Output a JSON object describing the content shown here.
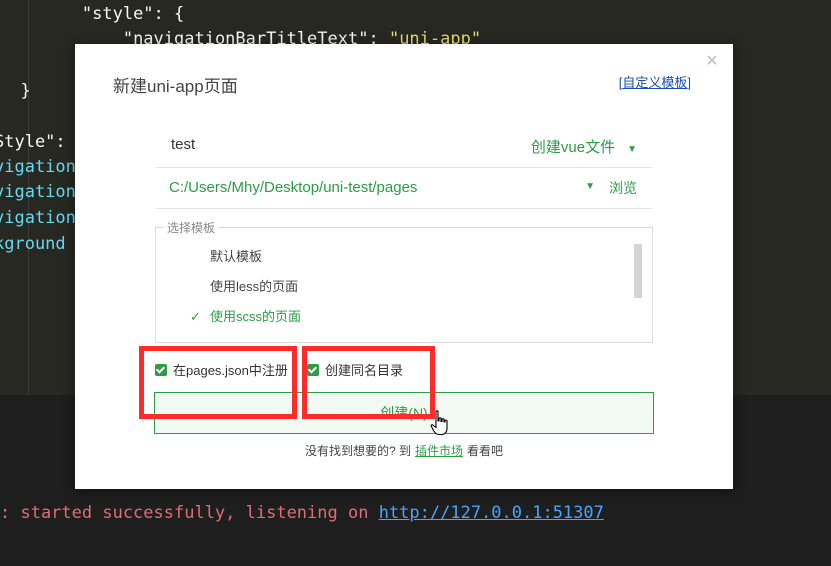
{
  "editor": {
    "lines": [
      {
        "indent": "        ",
        "key": "\"style\"",
        "rest": ": {"
      },
      {
        "indent": "            ",
        "key": "\"navigationBarTitleText\"",
        "rest": ": ",
        "value": "\"uni-app\""
      },
      {
        "indent": "        ",
        "key": "",
        "rest": "}"
      },
      {
        "indent": "  ",
        "key": "",
        "rest": "}"
      }
    ],
    "side_lines": [
      "Style\":",
      "vigation",
      "vigation",
      "vigation",
      "kground"
    ]
  },
  "terminal": {
    "prefix": ": started successfully, listening on ",
    "url": "http://127.0.0.1:51307"
  },
  "dialog": {
    "title": "新建uni-app页面",
    "close_glyph": "×",
    "custom_template": {
      "open": "[",
      "label": "自定义模板",
      "close": "]"
    },
    "name_value": "test",
    "file_type": "创建vue文件",
    "path_value": "C:/Users/Mhy/Desktop/uni-test/pages",
    "browse_label": "浏览",
    "template_legend": "选择模板",
    "templates": [
      {
        "label": "默认模板",
        "selected": false
      },
      {
        "label": "使用less的页面",
        "selected": false
      },
      {
        "label": "使用scss的页面",
        "selected": true
      }
    ],
    "check_glyph": "✓",
    "register_label": "在pages.json中注册",
    "same_dir_label": "创建同名目录",
    "create_button": "创建(N)",
    "footer": {
      "before": "没有找到想要的? 到",
      "market": "插件市场",
      "after": "看看吧"
    }
  },
  "colors": {
    "accent_green": "#2a9d45",
    "annotation_red": "#ff2a2a",
    "link_blue": "#1a4fb0"
  }
}
